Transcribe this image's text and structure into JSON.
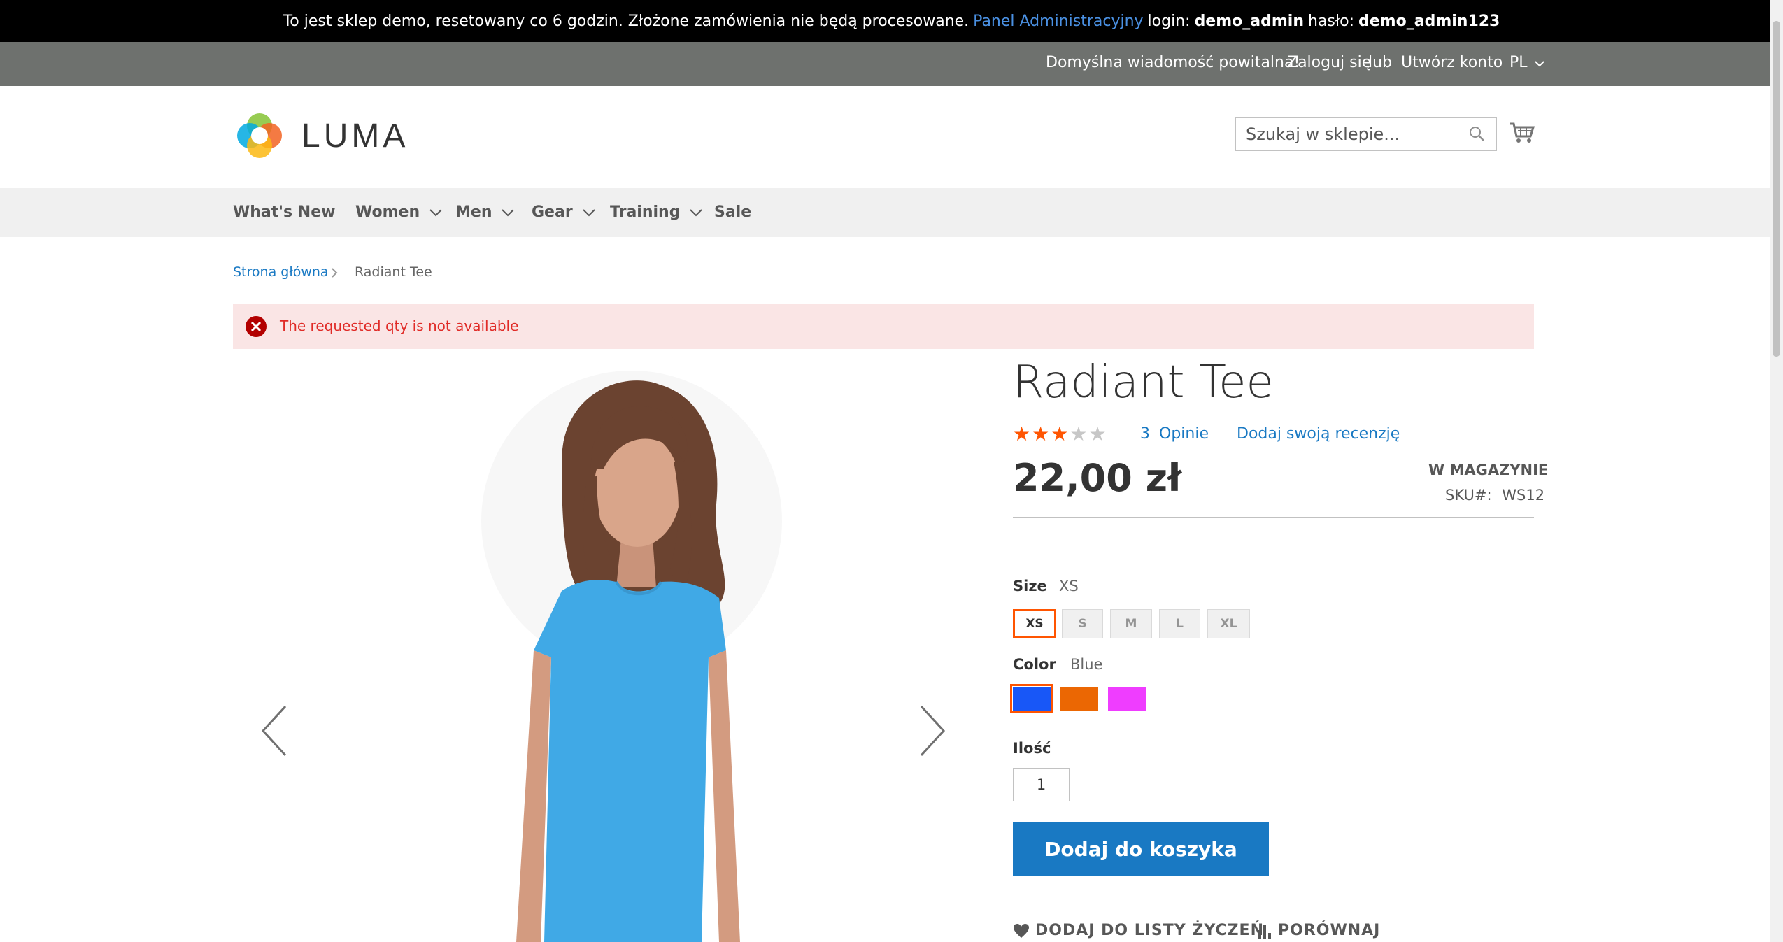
{
  "demo_notice": {
    "text": "To jest sklep demo, resetowany co 6 godzin. Złożone zamówienia nie będą procesowane.",
    "admin_link": "Panel Administracyjny",
    "login_label": "login:",
    "login_value": "demo_admin",
    "password_label": "hasło:",
    "password_value": "demo_admin123"
  },
  "panel": {
    "welcome": "Domyślna wiadomość powitalna!",
    "sign_in": "Zaloguj się",
    "or": "lub",
    "create_account": "Utwórz konto",
    "language": "PL"
  },
  "header": {
    "logo_text": "LUMA",
    "search_placeholder": "Szukaj w sklepie..."
  },
  "nav": {
    "items": [
      {
        "label": "What's New",
        "has_submenu": false
      },
      {
        "label": "Women",
        "has_submenu": true
      },
      {
        "label": "Men",
        "has_submenu": true
      },
      {
        "label": "Gear",
        "has_submenu": true
      },
      {
        "label": "Training",
        "has_submenu": true
      },
      {
        "label": "Sale",
        "has_submenu": false
      }
    ]
  },
  "breadcrumb": {
    "home": "Strona główna",
    "current": "Radiant Tee"
  },
  "message": {
    "type": "error",
    "text": "The requested qty is not available"
  },
  "product": {
    "name": "Radiant Tee",
    "rating_stars": 3,
    "rating_max": 5,
    "reviews_count": "3",
    "reviews_label": "Opinie",
    "add_review": "Dodaj swoją recenzję",
    "price": "22,00 zł",
    "stock": "W MAGAZYNIE",
    "sku_label": "SKU#:",
    "sku": "WS12",
    "size_label": "Size",
    "size_selected": "XS",
    "sizes": [
      "XS",
      "S",
      "M",
      "L",
      "XL"
    ],
    "color_label": "Color",
    "color_selected": "Blue",
    "colors": [
      {
        "name": "Blue",
        "hex": "#1857f7"
      },
      {
        "name": "Orange",
        "hex": "#eb6703"
      },
      {
        "name": "Purple",
        "hex": "#ef3dff"
      }
    ],
    "qty_label": "Ilość",
    "qty": "1",
    "add_to_cart": "Dodaj do koszyka",
    "wishlist": "DODAJ DO LISTY ŻYCZEŃ",
    "compare": "PORÓWNAJ"
  },
  "colors": {
    "accent": "#1979c3",
    "selected_border": "#ff5501",
    "star": "#ff5501",
    "error_bg": "#fae5e5",
    "error_text": "#e02b27"
  }
}
